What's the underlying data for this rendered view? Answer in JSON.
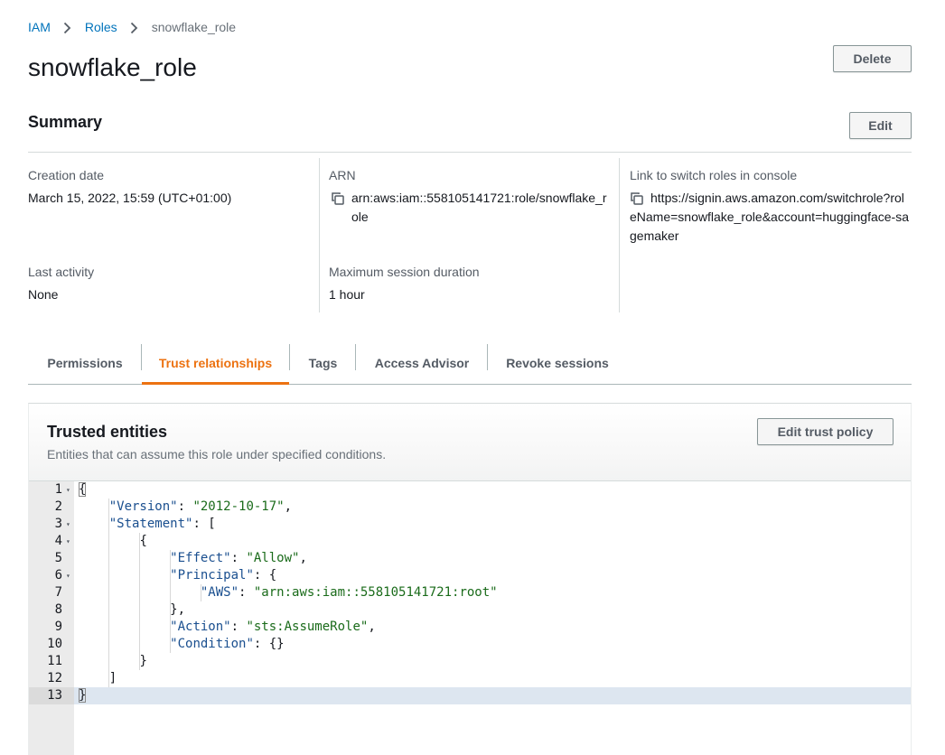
{
  "breadcrumb": {
    "items": [
      "IAM",
      "Roles"
    ],
    "current": "snowflake_role"
  },
  "page": {
    "title": "snowflake_role",
    "delete_label": "Delete"
  },
  "summary": {
    "title": "Summary",
    "edit_label": "Edit",
    "creation_date_label": "Creation date",
    "creation_date_value": "March 15, 2022, 15:59 (UTC+01:00)",
    "arn_label": "ARN",
    "arn_value_line1": "arn:aws:iam::558105141721:role/snowflake_r",
    "arn_value_line2": "ole",
    "switch_label": "Link to switch roles in console",
    "switch_value_line1": "https://signin.aws.amazon.com/switchrole?rol",
    "switch_value_line2": "eName=snowflake_role&account=huggingface-sa",
    "switch_value_line3": "gemaker",
    "last_activity_label": "Last activity",
    "last_activity_value": "None",
    "max_session_label": "Maximum session duration",
    "max_session_value": "1 hour"
  },
  "tabs": [
    {
      "label": "Permissions",
      "active": false
    },
    {
      "label": "Trust relationships",
      "active": true
    },
    {
      "label": "Tags",
      "active": false
    },
    {
      "label": "Access Advisor",
      "active": false
    },
    {
      "label": "Revoke sessions",
      "active": false
    }
  ],
  "trusted": {
    "title": "Trusted entities",
    "description": "Entities that can assume this role under specified conditions.",
    "edit_label": "Edit trust policy"
  },
  "editor": {
    "lines": [
      {
        "n": "1",
        "fold": true
      },
      {
        "n": "2",
        "fold": false
      },
      {
        "n": "3",
        "fold": true
      },
      {
        "n": "4",
        "fold": true
      },
      {
        "n": "5",
        "fold": false
      },
      {
        "n": "6",
        "fold": true
      },
      {
        "n": "7",
        "fold": false
      },
      {
        "n": "8",
        "fold": false
      },
      {
        "n": "9",
        "fold": false
      },
      {
        "n": "10",
        "fold": false
      },
      {
        "n": "11",
        "fold": false
      },
      {
        "n": "12",
        "fold": false
      },
      {
        "n": "13",
        "fold": false
      }
    ],
    "tokens": {
      "open_brace": "{",
      "version_key": "\"Version\"",
      "version_val": "\"2012-10-17\"",
      "statement_key": "\"Statement\"",
      "open_bracket": "[",
      "stmt_open": "{",
      "effect_key": "\"Effect\"",
      "effect_val": "\"Allow\"",
      "principal_key": "\"Principal\"",
      "principal_open": "{",
      "aws_key": "\"AWS\"",
      "aws_val": "\"arn:aws:iam::558105141721:root\"",
      "principal_close": "},",
      "action_key": "\"Action\"",
      "action_val": "\"sts:AssumeRole\"",
      "condition_key": "\"Condition\"",
      "condition_val": "{}",
      "stmt_close": "}",
      "close_bracket": "]",
      "close_brace": "}",
      "colon": ": ",
      "comma": ","
    }
  }
}
